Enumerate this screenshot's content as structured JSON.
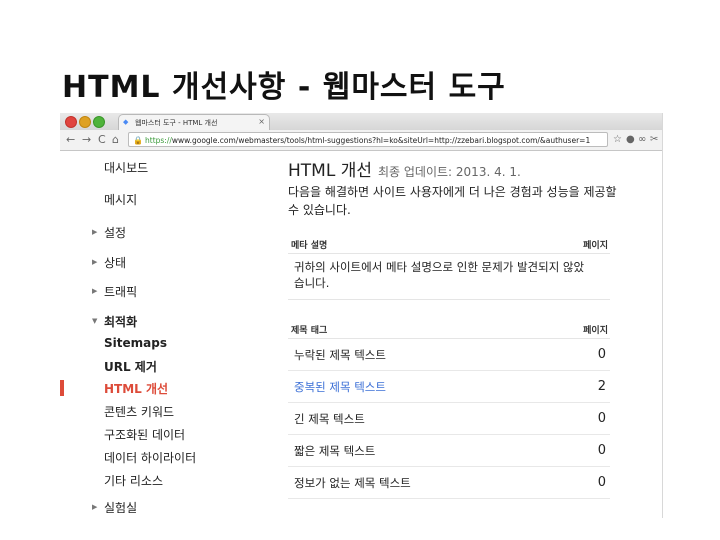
{
  "slide": {
    "title": "HTML 개선사항 - 웹마스터 도구"
  },
  "browser": {
    "tab_title": "웹마스터 도구 - HTML 개선",
    "url_scheme": "https://",
    "url_rest": "www.google.com/webmasters/tools/html-suggestions?hl=ko&siteUrl=http://zzebari.blogspot.com/&authuser=1",
    "nav": {
      "back": "←",
      "forward": "→",
      "reload": "C",
      "home": "⌂"
    }
  },
  "sidebar": {
    "dashboard": "대시보드",
    "messages": "메시지",
    "settings": "설정",
    "status": "상태",
    "traffic": "트래픽",
    "optimization": "최적화",
    "sub": {
      "sitemaps": "Sitemaps",
      "url_removal": "URL 제거",
      "html_improvements": "HTML 개선",
      "content_keywords": "콘텐츠 키워드",
      "structured_data": "구조화된 데이터",
      "data_highlighter": "데이터 하이라이터",
      "other_resources": "기타 리소스"
    },
    "labs": "실험실"
  },
  "main": {
    "title": "HTML 개선",
    "date": "최종 업데이트: 2013. 4. 1.",
    "intro": "다음을 해결하면 사이트 사용자에게 더 나은 경험과 성능을 제공할 수 있습니다.",
    "meta_table": {
      "header": "메타 설명",
      "page_col": "페이지",
      "message": "귀하의 사이트에서 메타 설명으로 인한 문제가 발견되지 않았습니다."
    },
    "title_table": {
      "header": "제목 태그",
      "page_col": "페이지",
      "rows": [
        {
          "label": "누락된 제목 텍스트",
          "count": "0"
        },
        {
          "label": "중복된 제목 텍스트",
          "count": "2"
        },
        {
          "label": "긴 제목 텍스트",
          "count": "0"
        },
        {
          "label": "짧은 제목 텍스트",
          "count": "0"
        },
        {
          "label": "정보가 없는 제목 텍스트",
          "count": "0"
        }
      ]
    }
  },
  "colors": {
    "accent_active": "#dd4b39",
    "link": "#3b6fd6"
  }
}
